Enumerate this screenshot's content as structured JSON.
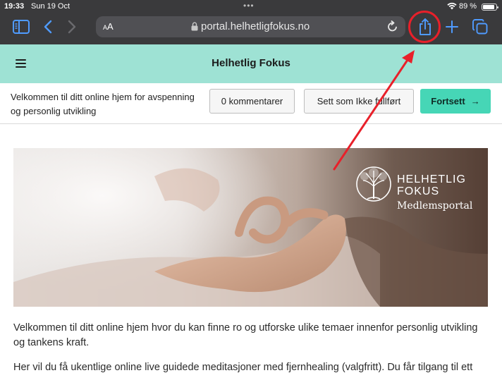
{
  "status_bar": {
    "time": "19:33",
    "date": "Sun 19 Oct",
    "battery_percent": "89 %",
    "battery_level": 0.89
  },
  "browser": {
    "text_size_label_small": "A",
    "text_size_label_large": "A",
    "url": "portal.helhetligfokus.no",
    "icons": [
      "sidebar-icon",
      "back-icon",
      "forward-icon",
      "lock-icon",
      "reload-icon",
      "share-icon",
      "plus-icon",
      "tabs-icon"
    ]
  },
  "site": {
    "title": "Helhetlig Fokus"
  },
  "lesson": {
    "title": "Velkommen til ditt online hjem for avs­penning og personlig utvikling",
    "comments_button": "0 kommentarer",
    "mark_incomplete_button": "Sett som Ikke fullført",
    "continue_button": "Fortsett",
    "continue_arrow": "→"
  },
  "hero": {
    "brand_line1": "HELHETLIG",
    "brand_line2": "FOKUS",
    "brand_line3": "Medlemsportal"
  },
  "content": {
    "paragraph1": "Velkommen til ditt online hjem hvor du kan finne ro og utforske ulike temaer innenfor personlig utvikling og tankens kraft.",
    "paragraph2": "Her vil du få ukentlige online live guidede meditasjoner med fjernhealing (valgfritt). Du får tilgang til ett"
  },
  "colors": {
    "toolbar": "#3a3a3c",
    "header": "#9ee2d4",
    "accent": "#46d6b6",
    "annotation": "#e8202a"
  }
}
